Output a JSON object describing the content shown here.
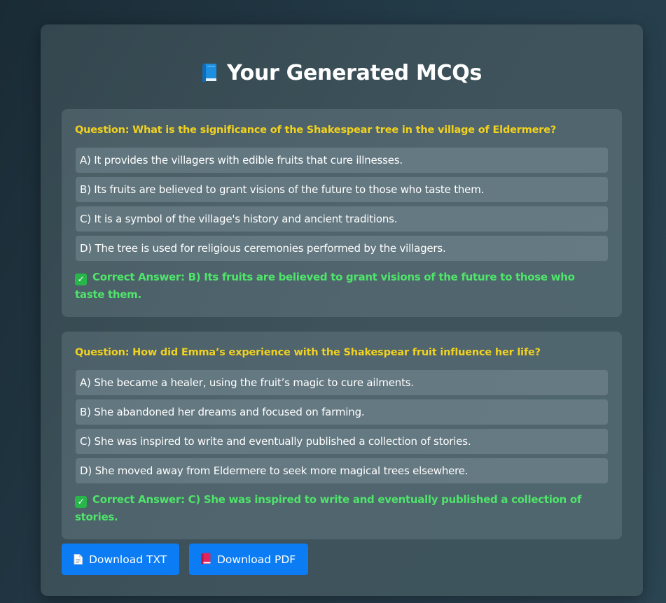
{
  "page": {
    "title": "Your Generated MCQs",
    "title_icon": "blue-book-icon"
  },
  "questions": [
    {
      "question": "Question: What is the significance of the Shakespear tree in the village of Eldermere?",
      "options": [
        "A) It provides the villagers with edible fruits that cure illnesses.",
        "B) Its fruits are believed to grant visions of the future to those who taste them.",
        "C) It is a symbol of the village's history and ancient traditions.",
        "D) The tree is used for religious ceremonies performed by the villagers."
      ],
      "answer": "Correct Answer: B) Its fruits are believed to grant visions of the future to those who taste them."
    },
    {
      "question": "Question: How did Emma’s experience with the Shakespear fruit influence her life?",
      "options": [
        "A) She became a healer, using the fruit’s magic to cure ailments.",
        "B) She abandoned her dreams and focused on farming.",
        "C) She was inspired to write and eventually published a collection of stories.",
        "D) She moved away from Eldermere to seek more magical trees elsewhere."
      ],
      "answer": "Correct Answer: C) She was inspired to write and eventually published a collection of stories."
    }
  ],
  "buttons": {
    "download_txt": "Download TXT",
    "download_pdf": "Download PDF"
  },
  "colors": {
    "question_text": "#f2d21f",
    "answer_text": "#4ee56a",
    "button_bg": "#0b7cf4"
  }
}
